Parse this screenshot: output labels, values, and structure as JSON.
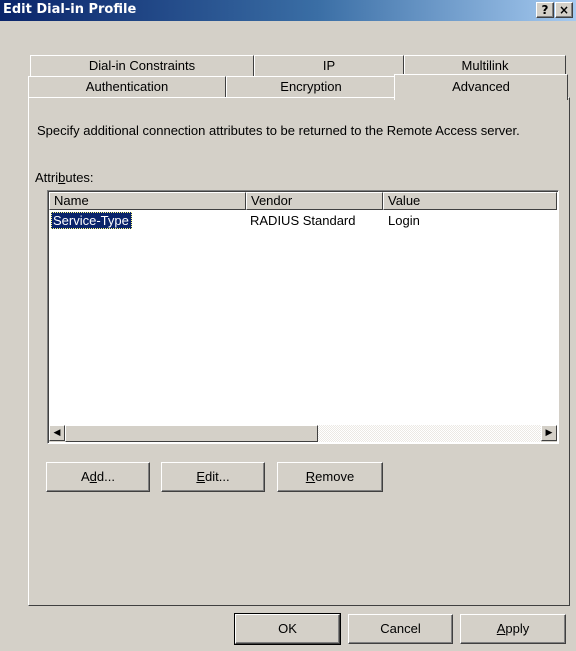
{
  "window": {
    "title": "Edit Dial-in Profile",
    "help_button": "?",
    "close_button": "×"
  },
  "tabs_row1": [
    {
      "label": "Dial-in Constraints"
    },
    {
      "label": "IP"
    },
    {
      "label": "Multilink"
    }
  ],
  "tabs_row2": [
    {
      "label": "Authentication"
    },
    {
      "label": "Encryption"
    },
    {
      "label": "Advanced",
      "active": true
    }
  ],
  "advanced": {
    "description": "Specify additional connection attributes to be returned to the Remote Access server.",
    "attributes_label_pre": "Attri",
    "attributes_label_mnemonic": "b",
    "attributes_label_post": "utes:",
    "columns": [
      "Name",
      "Vendor",
      "Value"
    ],
    "rows": [
      {
        "name": "Service-Type",
        "vendor": "RADIUS Standard",
        "value": "Login",
        "selected": true
      }
    ],
    "scroll_left_icon": "◀",
    "scroll_right_icon": "▶",
    "buttons": {
      "add": {
        "pre": "A",
        "mnemonic": "d",
        "post": "d..."
      },
      "edit": {
        "pre": "",
        "mnemonic": "E",
        "post": "dit..."
      },
      "remove": {
        "pre": "",
        "mnemonic": "R",
        "post": "emove"
      }
    }
  },
  "footer": {
    "ok": "OK",
    "cancel": "Cancel",
    "apply_mnemonic": "A",
    "apply_rest": "pply"
  }
}
